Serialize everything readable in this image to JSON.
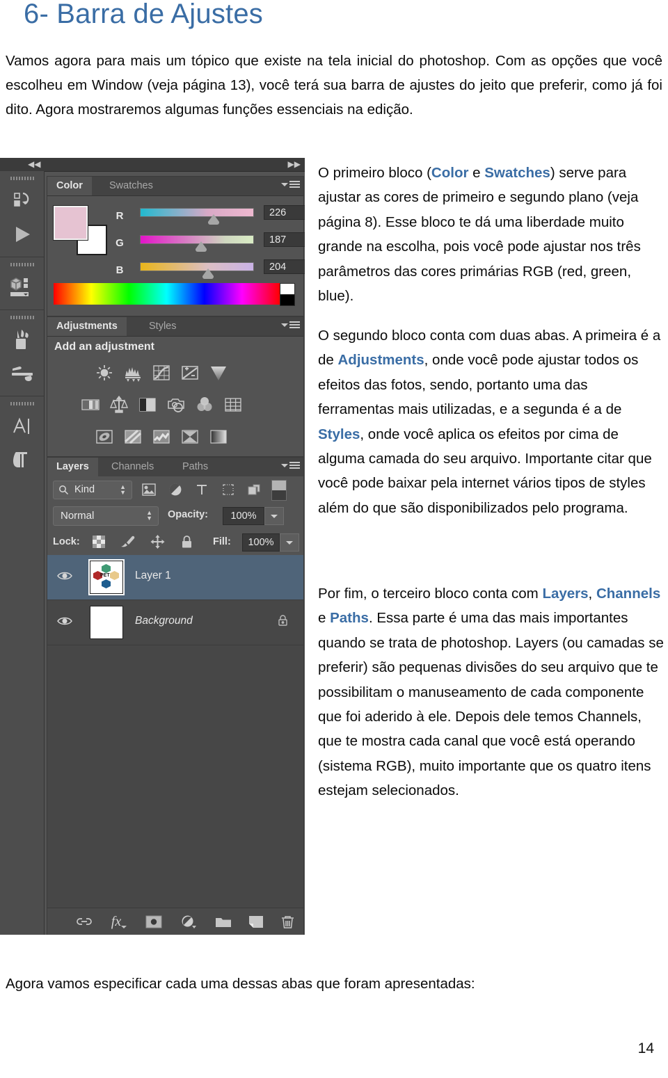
{
  "document": {
    "title": "6- Barra de Ajustes",
    "intro": "Vamos agora para mais um tópico que existe na tela inicial do photoshop.  Com as opções que você escolheu em Window (veja página 13), você terá sua barra de ajustes do jeito que preferir, como já foi dito. Agora mostraremos  algumas funções essenciais na edição.",
    "closing": "Agora vamos especificar cada uma dessas abas que foram apresentadas:",
    "page_number": "14",
    "accent_color": "#3a6da5"
  },
  "paragraphs": {
    "color_block": {
      "p1": "O primeiro bloco (",
      "kw1": "Color",
      "p2": " e ",
      "kw2": "Swatches",
      "p3": ") serve para ajustar as cores de primeiro e segundo plano (veja página 8). Esse bloco te dá uma liberdade muito grande na escolha, pois você pode ajustar nos três parâmetros das cores primárias RGB (red, green, blue)."
    },
    "adjust_block": {
      "p1": "O segundo bloco conta com duas abas. A primeira é a de ",
      "kw1": "Adjustments",
      "p2": ", onde você pode ajustar todos os efeitos das fotos, sendo, portanto uma das ferramentas mais utilizadas, e a segunda é a de ",
      "kw2": "Styles",
      "p3": ", onde você aplica os efeitos por cima de alguma camada do seu arquivo. Importante  citar que você pode baixar pela internet vários tipos de styles além do que são disponibilizados pelo programa."
    },
    "layers_block": {
      "p1": "Por fim, o terceiro bloco conta com ",
      "kw1": "Layers",
      "p2": ", ",
      "kw2": "Channels",
      "p3": " e ",
      "kw3": "Paths",
      "p4": ". Essa parte é uma das mais importantes quando se trata de photoshop. Layers (ou camadas se preferir) são pequenas divisões do seu arquivo que te possibilitam o manuseamento de cada componente que foi aderido à ele. Depois dele temos Channels, que te mostra cada canal que você está operando (sistema RGB), muito importante que os quatro itens estejam selecionados."
    }
  },
  "photoshop": {
    "color_panel": {
      "tabs": [
        "Color",
        "Swatches"
      ],
      "active_tab": "Color",
      "foreground_color": "#e6c3d2",
      "background_color": "#ffffff",
      "sliders": [
        {
          "label": "R",
          "value": "226"
        },
        {
          "label": "G",
          "value": "187"
        },
        {
          "label": "B",
          "value": "204"
        }
      ]
    },
    "adjustments_panel": {
      "tabs": [
        "Adjustments",
        "Styles"
      ],
      "active_tab": "Adjustments",
      "heading": "Add an adjustment",
      "row1_icons": [
        "brightness-contrast-icon",
        "levels-icon",
        "curves-icon",
        "exposure-icon",
        "vibrance-icon"
      ],
      "row2_icons": [
        "hue-saturation-icon",
        "color-balance-icon",
        "black-white-icon",
        "photo-filter-icon",
        "channel-mixer-icon",
        "color-lookup-icon"
      ],
      "row3_icons": [
        "invert-icon",
        "posterize-icon",
        "threshold-icon",
        "selective-color-icon",
        "gradient-map-icon"
      ]
    },
    "layers_panel": {
      "tabs": [
        "Layers",
        "Channels",
        "Paths"
      ],
      "active_tab": "Layers",
      "filter": {
        "kind_label": "Kind",
        "filter_icons": [
          "pixel-layer-filter-icon",
          "adjustment-layer-filter-icon",
          "type-layer-filter-icon",
          "shape-layer-filter-icon",
          "smart-object-filter-icon"
        ]
      },
      "blend_mode": "Normal",
      "opacity_label": "Opacity:",
      "opacity_value": "100%",
      "lock_label": "Lock:",
      "lock_icons": [
        "lock-transparency-icon",
        "lock-image-icon",
        "lock-position-icon",
        "lock-all-icon"
      ],
      "fill_label": "Fill:",
      "fill_value": "100%",
      "rows": [
        {
          "name": "Layer 1",
          "selected": true,
          "locked": false,
          "visible": true
        },
        {
          "name": "Background",
          "selected": false,
          "locked": true,
          "visible": true
        }
      ],
      "footer_icons": [
        "link-layers-icon",
        "layer-style-fx-icon",
        "layer-mask-icon",
        "new-fill-adjustment-icon",
        "new-group-icon",
        "new-layer-icon",
        "delete-layer-icon"
      ],
      "footer_fx_label": "fx"
    },
    "tool_rail_icons": [
      "history-icon",
      "actions-play-icon",
      "3d-icon",
      "brush-presets-icon",
      "brush-settings-icon",
      "character-icon",
      "paragraph-icon"
    ],
    "collapse_left_icon": "collapse-left-icon",
    "collapse_right_icon": "collapse-right-icon"
  }
}
